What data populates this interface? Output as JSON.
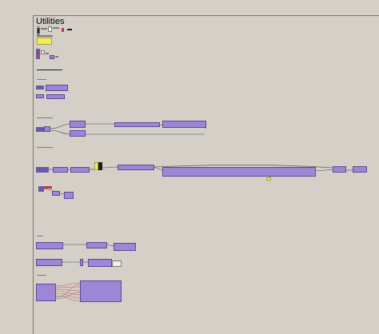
{
  "canvas": {
    "group_title": "Utilities",
    "background": "#d4d0c8",
    "component_color": "#9d86d6",
    "panel_color": "#f3ec5c",
    "wire_color": "#444444",
    "highlight_wire_color": "#d06060"
  },
  "sections": [
    {
      "id": "header-params"
    },
    {
      "id": "toggle-group"
    },
    {
      "id": "chain-1"
    },
    {
      "id": "chain-2"
    },
    {
      "id": "chain-3-long"
    },
    {
      "id": "chain-4"
    },
    {
      "id": "chain-5"
    },
    {
      "id": "chain-6"
    },
    {
      "id": "fan-out"
    }
  ]
}
